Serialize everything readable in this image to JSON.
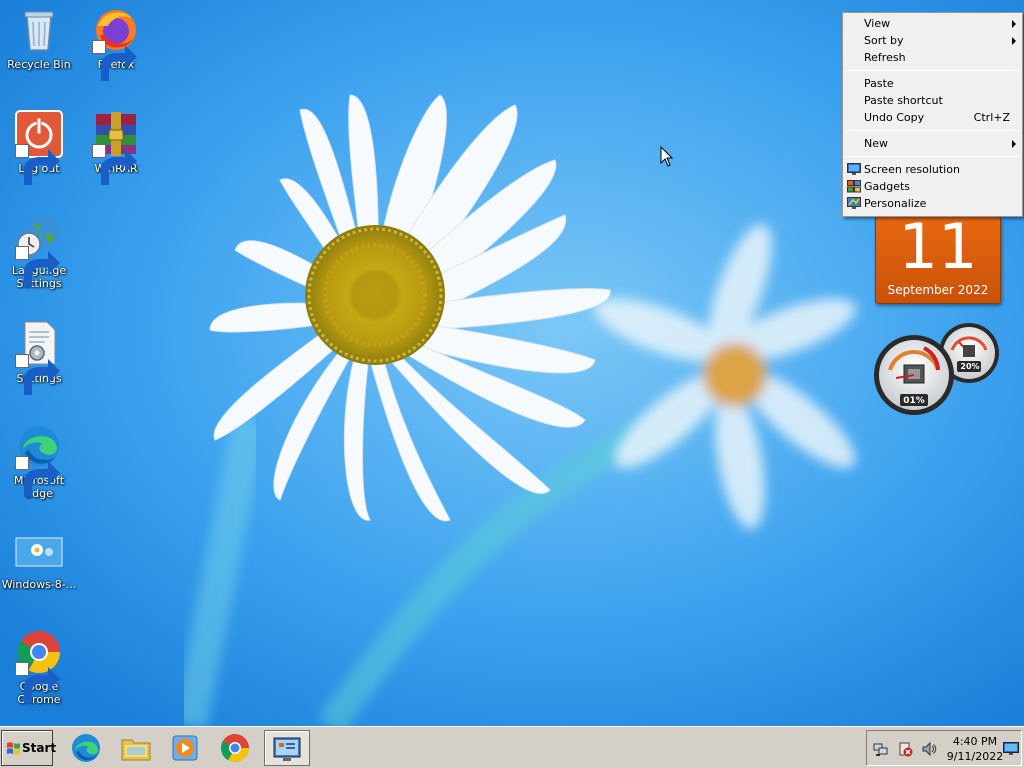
{
  "desktop": {
    "icons": [
      {
        "label": "Recycle Bin",
        "icon": "recycle-bin-icon"
      },
      {
        "label": "Firefox",
        "icon": "firefox-icon"
      },
      {
        "label": "Log out",
        "icon": "power-icon"
      },
      {
        "label": "WinRAR",
        "icon": "winrar-icon"
      },
      {
        "label": "Language Settings",
        "icon": "globe-clock-icon"
      },
      {
        "label": "Settings",
        "icon": "settings-document-icon"
      },
      {
        "label": "Microsoft Edge",
        "icon": "edge-icon"
      },
      {
        "label": "Windows-8-...",
        "icon": "image-file-icon"
      },
      {
        "label": "Google Chrome",
        "icon": "chrome-icon"
      }
    ]
  },
  "context_menu": {
    "items": {
      "view": {
        "label": "View",
        "submenu": true
      },
      "sort_by": {
        "label": "Sort by",
        "submenu": true
      },
      "refresh": {
        "label": "Refresh"
      },
      "paste": {
        "label": "Paste"
      },
      "paste_shortcut": {
        "label": "Paste shortcut"
      },
      "undo_copy": {
        "label": "Undo Copy",
        "accelerator": "Ctrl+Z"
      },
      "new": {
        "label": "New",
        "submenu": true
      },
      "screen_resolution": {
        "label": "Screen resolution",
        "icon": "monitor-icon"
      },
      "gadgets": {
        "label": "Gadgets",
        "icon": "gadgets-icon"
      },
      "personalize": {
        "label": "Personalize",
        "icon": "personalize-icon"
      }
    }
  },
  "gadgets": {
    "calendar": {
      "day": "11",
      "month_year": "September 2022",
      "color": "#d85c0c"
    },
    "cpu_meter": {
      "cpu_percent_label": "01%",
      "memory_percent_label": "20%"
    }
  },
  "taskbar": {
    "start_label": "Start",
    "pinned_apps": [
      "edge-icon",
      "file-explorer-icon",
      "media-player-icon",
      "chrome-icon",
      "control-panel-icon"
    ],
    "active_app": "control-panel-icon",
    "tray": {
      "icons": [
        "network-icon",
        "action-center-icon",
        "volume-icon"
      ],
      "time": "4:40 PM",
      "date": "9/11/2022"
    }
  }
}
